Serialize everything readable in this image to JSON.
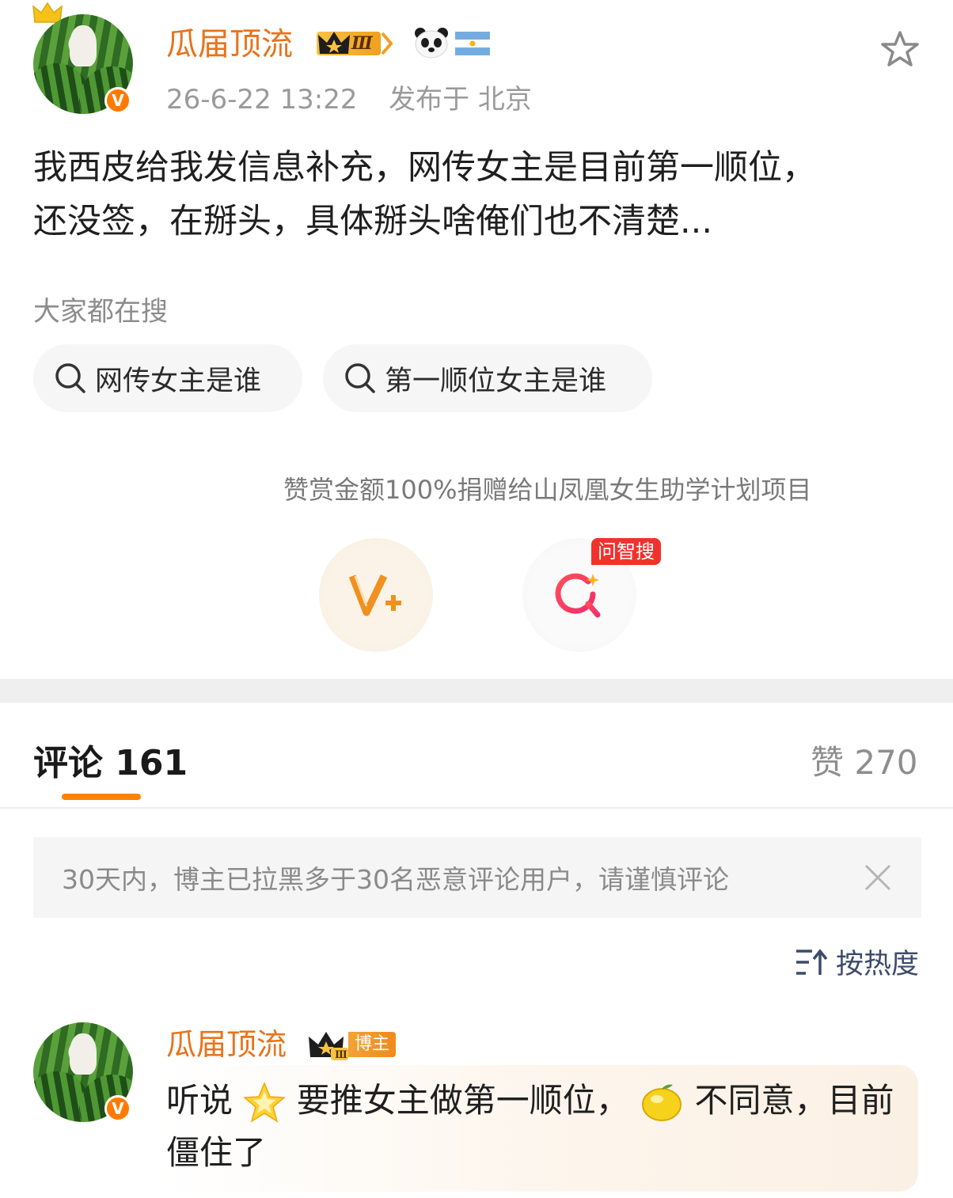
{
  "post": {
    "username": "瓜届顶流",
    "level_badge": "Ⅲ",
    "timestamp": "26-6-22 13:22",
    "location": "发布于 北京",
    "text_line1": "我西皮给我发信息补充，网传女主是目前第一顺位，",
    "text_line2": "还没签，在掰头，具体掰头啥俺们也不清楚...",
    "verified_mark": "V"
  },
  "trending": {
    "label": "大家都在搜",
    "chips": [
      "网传女主是谁",
      "第一顺位女主是谁"
    ]
  },
  "reward": {
    "donation_text": "赞赏金额100%捐赠给山凤凰女生助学计划项目",
    "ask_tag": "问智搜"
  },
  "comments_bar": {
    "comments_label": "评论 161",
    "likes_label": "赞 270"
  },
  "notice": {
    "text": "30天内，博主已拉黑多于30名恶意评论用户，请谨慎评论"
  },
  "sort": {
    "label": "按热度"
  },
  "comment": {
    "username": "瓜届顶流",
    "level_badge": "Ⅲ",
    "role_tag": "博主",
    "text_part1": "听说",
    "text_part2": "要推女主做第一顺位，",
    "text_part3": "不同意，目前",
    "text_line2": "僵住了"
  },
  "colors": {
    "username": "#e8731a",
    "accent": "#ff8200",
    "tag_red": "#f0322d",
    "notice_bg": "#f5f5f5"
  }
}
